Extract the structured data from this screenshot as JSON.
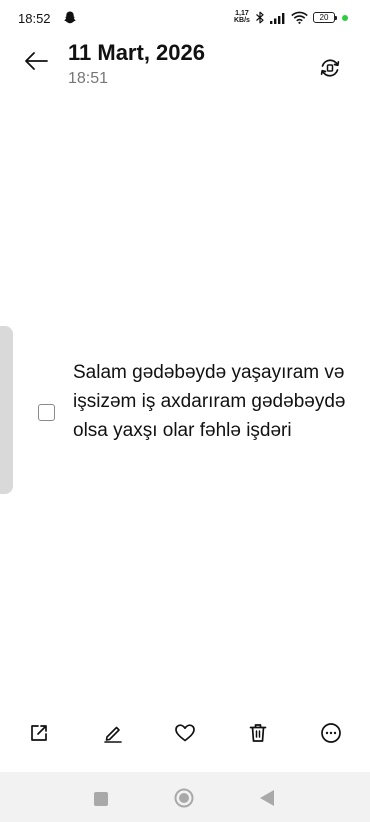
{
  "status_bar": {
    "time": "18:52",
    "net_speed_value": "1,17",
    "net_speed_unit": "KB/s",
    "battery": "20",
    "icons": [
      "snapchat-ghost-icon",
      "bluetooth-icon",
      "signal-icon",
      "wifi-icon",
      "battery-icon"
    ]
  },
  "header": {
    "date": "11 Mart, 2026",
    "time": "18:51",
    "back_icon": "arrow-left-icon",
    "sync_icon": "sync-icon"
  },
  "note": {
    "items": [
      {
        "checked": false,
        "text": "Salam gədəbəydə yaşayıram və işsizəm iş axdarıram gədəbəydə olsa yaxşı olar fəhlə işdəri"
      }
    ]
  },
  "toolbar": {
    "icons": [
      "share-icon",
      "edit-icon",
      "heart-icon",
      "trash-icon",
      "more-icon"
    ]
  },
  "nav_bar": {
    "icons": [
      "recent-apps-icon",
      "home-icon",
      "back-icon"
    ]
  },
  "colors": {
    "background": "#ffffff",
    "text": "#111111",
    "secondary_text": "#777777",
    "edge_handle": "#d9d9d9",
    "nav_bar": "#f2f2f2",
    "status_dot": "#2ecc40"
  }
}
